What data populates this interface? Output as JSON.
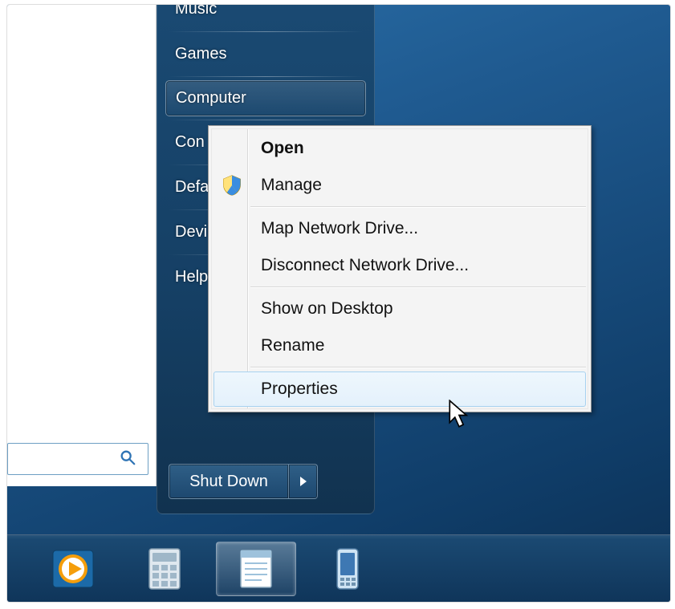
{
  "start_menu": {
    "right_column": [
      {
        "label": "Music",
        "selected": false,
        "truncated": false
      },
      {
        "divider": true
      },
      {
        "label": "Games",
        "selected": false,
        "truncated": false
      },
      {
        "divider": true
      },
      {
        "label": "Computer",
        "selected": true,
        "truncated": false
      },
      {
        "divider": true
      },
      {
        "label": "Control Panel",
        "selected": false,
        "truncated": true,
        "visible": "Con"
      },
      {
        "divider": true
      },
      {
        "label": "Default Programs",
        "selected": false,
        "truncated": true,
        "visible": "Defa"
      },
      {
        "divider": true
      },
      {
        "label": "Devices and Printers",
        "selected": false,
        "truncated": true,
        "visible": "Devi"
      },
      {
        "divider": true
      },
      {
        "label": "Help and Support",
        "selected": false,
        "truncated": true,
        "visible": "Help"
      }
    ],
    "shutdown_label": "Shut Down",
    "search_placeholder": ""
  },
  "context_menu": {
    "items": [
      {
        "label": "Open",
        "bold": true
      },
      {
        "label": "Manage",
        "icon": "uac-shield"
      },
      {
        "separator": true
      },
      {
        "label": "Map Network Drive..."
      },
      {
        "label": "Disconnect Network Drive..."
      },
      {
        "separator": true
      },
      {
        "label": "Show on Desktop"
      },
      {
        "label": "Rename"
      },
      {
        "separator": true
      },
      {
        "label": "Properties",
        "hovered": true
      }
    ]
  },
  "taskbar": {
    "items": [
      {
        "name": "media-player",
        "active": false
      },
      {
        "name": "calculator",
        "active": false
      },
      {
        "name": "notepad",
        "active": true
      },
      {
        "name": "mobile-pc-settings",
        "active": false
      }
    ]
  }
}
